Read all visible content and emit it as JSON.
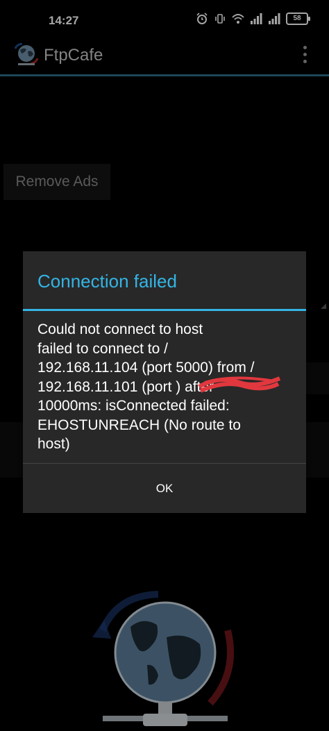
{
  "status_bar": {
    "time": "14:27",
    "battery": "58",
    "icons": [
      "alarm-icon",
      "vibrate-icon",
      "wifi-icon",
      "signal-icon",
      "signal-icon",
      "battery-icon"
    ]
  },
  "app_bar": {
    "title": "FtpCafe",
    "accent_color": "#2f6f86"
  },
  "main": {
    "remove_ads_label": "Remove Ads"
  },
  "dialog": {
    "title": "Connection failed",
    "message": "Could not connect to host\nfailed to connect to /\n192.168.11.104 (port 5000) from /\n192.168.11.101 (port       ) after\n10000ms: isConnected failed:\nEHOSTUNREACH (No route to\nhost)",
    "ok_label": "OK",
    "title_color": "#33b5e5"
  }
}
